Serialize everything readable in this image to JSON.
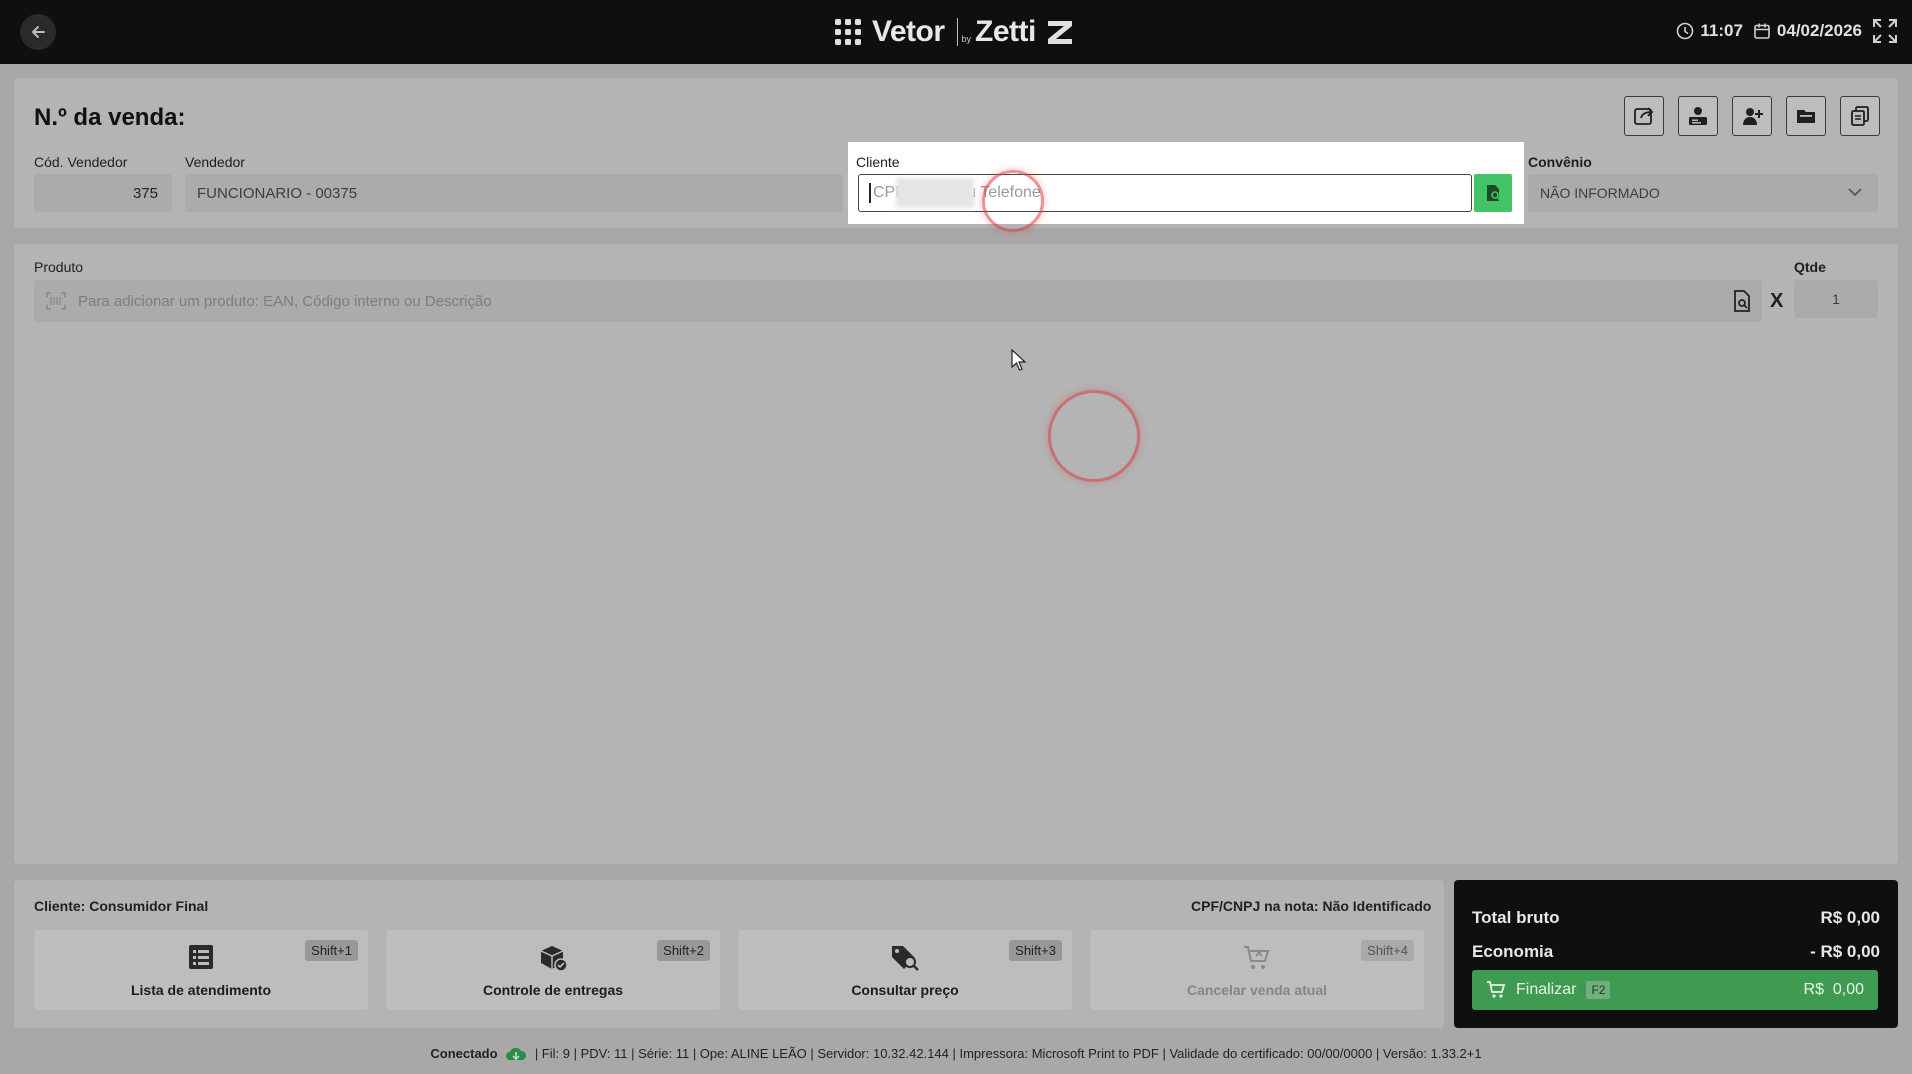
{
  "topbar": {
    "brand_left": "Vetor",
    "brand_by": "by",
    "brand_right": "Zetti",
    "time": "11:07",
    "date": "04/02/2026"
  },
  "header": {
    "title": "N.º da venda:",
    "cod_vendedor_label": "Cód. Vendedor",
    "cod_vendedor_value": "375",
    "vendedor_label": "Vendedor",
    "vendedor_value": "FUNCIONARIO - 00375",
    "cliente_label": "Cliente",
    "cliente_placeholder": "CPF, CNPJ ou Telefone",
    "convenio_label": "Convênio",
    "convenio_value": "NÃO INFORMADO"
  },
  "produto": {
    "label": "Produto",
    "placeholder": "Para adicionar um produto: EAN, Código interno ou Descrição",
    "multiply": "X",
    "qtde_label": "Qtde",
    "qtde_value": "1"
  },
  "bottom": {
    "cliente_info": "Cliente: Consumidor Final",
    "cpf_info": "CPF/CNPJ na nota: Não Identificado",
    "actions": [
      {
        "label": "Lista de atendimento",
        "shortcut": "Shift+1",
        "icon": "list-icon"
      },
      {
        "label": "Controle de entregas",
        "shortcut": "Shift+2",
        "icon": "box-check-icon"
      },
      {
        "label": "Consultar preço",
        "shortcut": "Shift+3",
        "icon": "tag-search-icon"
      },
      {
        "label": "Cancelar venda atual",
        "shortcut": "Shift+4",
        "icon": "cart-cancel-icon"
      }
    ]
  },
  "totals": {
    "bruto_label": "Total bruto",
    "bruto_value": "R$ 0,00",
    "economia_label": "Economia",
    "economia_value": "- R$ 0,00",
    "finalizar_label": "Finalizar",
    "finalizar_key": "F2",
    "finalizar_value": "R$  0,00"
  },
  "statusbar": {
    "connected": "Conectado",
    "info": "| Fil: 9 | PDV: 11 | Série: 11 | Ope: ALINE LEÃO | Servidor: 10.32.42.144 | Impressora: Microsoft Print to PDF | Validade do certificado: 00/00/0000 | Versão: 1.33.2+1"
  },
  "colors": {
    "topbar": "#0f0f0f",
    "accent_green": "#43c464",
    "finalizar_green": "#3f9a52"
  }
}
